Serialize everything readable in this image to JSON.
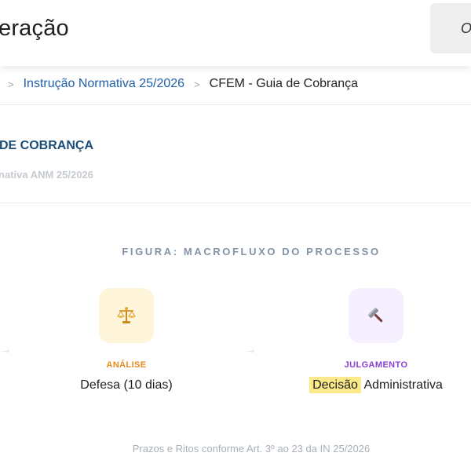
{
  "header": {
    "title": "eração",
    "button_label": "O"
  },
  "breadcrumb": {
    "items": [
      {
        "label": "Instrução Normativa 25/2026"
      },
      {
        "label": "CFEM - Guia de Cobrança"
      }
    ]
  },
  "document": {
    "title": "DE COBRANÇA",
    "subtitle": "nativa ANM 25/2026"
  },
  "figure": {
    "caption": "FIGURA: MACROFLUXO DO PROCESSO",
    "steps": [
      {
        "icon": "scales-icon",
        "label": "ANÁLISE",
        "label_color": "#ea8a1b",
        "icon_bg": "#fff5da",
        "description": "Defesa (10 dias)"
      },
      {
        "icon": "gavel-icon",
        "label": "JULGAMENTO",
        "label_color": "#8a3fd6",
        "icon_bg": "#f6efff",
        "description_highlight": "Decisão",
        "description_rest": " Administrativa"
      }
    ]
  },
  "footer": {
    "note": "Prazos e Ritos conforme Art. 3º ao 23 da IN 25/2026"
  },
  "colors": {
    "link": "#1f5fa8",
    "title": "#1b4d78",
    "highlight": "#fbe98a"
  }
}
